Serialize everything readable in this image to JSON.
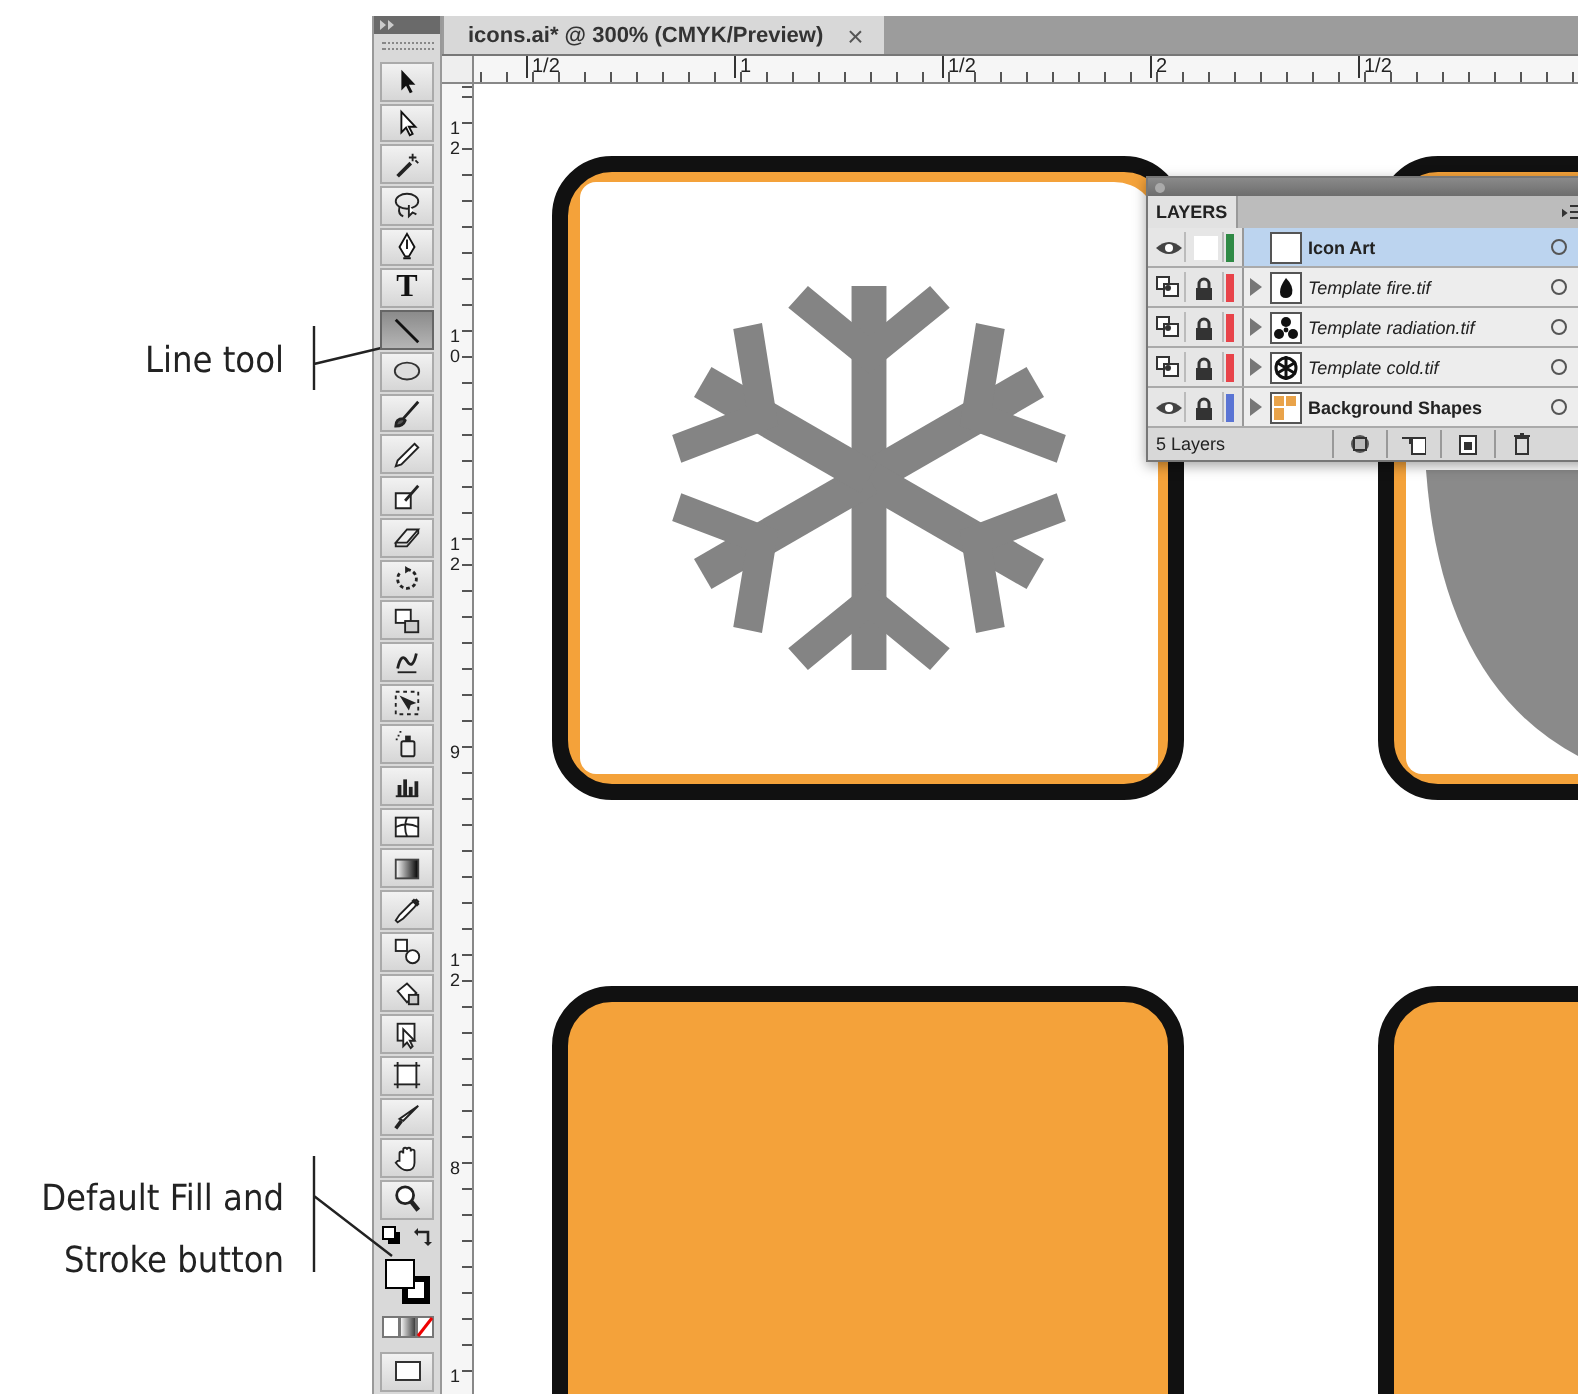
{
  "callouts": [
    {
      "text": "Line tool"
    },
    {
      "text": "Default Fill and Stroke button"
    }
  ],
  "toolbar": {
    "tools": [
      {
        "kind": "selection",
        "selected": false
      },
      {
        "kind": "direct-selection",
        "selected": false
      },
      {
        "kind": "magic-wand",
        "selected": false
      },
      {
        "kind": "lasso",
        "selected": false
      },
      {
        "kind": "pen",
        "selected": false
      },
      {
        "kind": "type",
        "glyph": "T",
        "selected": false
      },
      {
        "kind": "line",
        "selected": true
      },
      {
        "kind": "ellipse",
        "selected": false
      },
      {
        "kind": "paintbrush",
        "selected": false
      },
      {
        "kind": "pencil",
        "selected": false
      },
      {
        "kind": "blob-brush",
        "selected": false
      },
      {
        "kind": "eraser",
        "selected": false
      },
      {
        "kind": "rotate",
        "selected": false
      },
      {
        "kind": "scale",
        "selected": false
      },
      {
        "kind": "warp",
        "selected": false
      },
      {
        "kind": "free-transform",
        "selected": false
      },
      {
        "kind": "symbol-sprayer",
        "selected": false
      },
      {
        "kind": "graph",
        "selected": false
      },
      {
        "kind": "mesh",
        "selected": false
      },
      {
        "kind": "gradient",
        "selected": false
      },
      {
        "kind": "eyedropper",
        "selected": false
      },
      {
        "kind": "blend",
        "selected": false
      },
      {
        "kind": "live-paint",
        "selected": false
      },
      {
        "kind": "live-paint-selection",
        "selected": false
      },
      {
        "kind": "artboard",
        "selected": false
      },
      {
        "kind": "slice",
        "selected": false
      },
      {
        "kind": "hand",
        "selected": false
      },
      {
        "kind": "zoom",
        "selected": false
      }
    ]
  },
  "document": {
    "tab": {
      "title": "icons.ai* @ 300% (CMYK/Preview)",
      "close": "×"
    },
    "top_ruler": [
      "1/2",
      "1",
      "1/2",
      "2",
      "1/2"
    ],
    "left_ruler": [
      "12",
      "10",
      "12",
      "9",
      "12",
      "8",
      "1"
    ],
    "artwork": [
      {
        "kind": "snowflake"
      },
      {
        "kind": "shield"
      },
      {
        "kind": "blank"
      },
      {
        "kind": "blank"
      }
    ]
  },
  "layers_panel": {
    "title": "LAYERS",
    "layers": [
      {
        "name": "Icon Art",
        "kind": "layer",
        "visible": true,
        "locked": false,
        "expandable": false,
        "selected": true,
        "color": "#2f8a45"
      },
      {
        "name": "Template fire.tif",
        "kind": "template",
        "visible": true,
        "locked": true,
        "expandable": true,
        "selected": false,
        "color": "#e8434a"
      },
      {
        "name": "Template radiation.tif",
        "kind": "template",
        "visible": true,
        "locked": true,
        "expandable": true,
        "selected": false,
        "color": "#e8434a"
      },
      {
        "name": "Template cold.tif",
        "kind": "template",
        "visible": true,
        "locked": true,
        "expandable": true,
        "selected": false,
        "color": "#e8434a"
      },
      {
        "name": "Background Shapes",
        "kind": "layer",
        "visible": true,
        "locked": true,
        "expandable": true,
        "selected": false,
        "color": "#5a74d4"
      }
    ],
    "count": "5 Layers"
  }
}
